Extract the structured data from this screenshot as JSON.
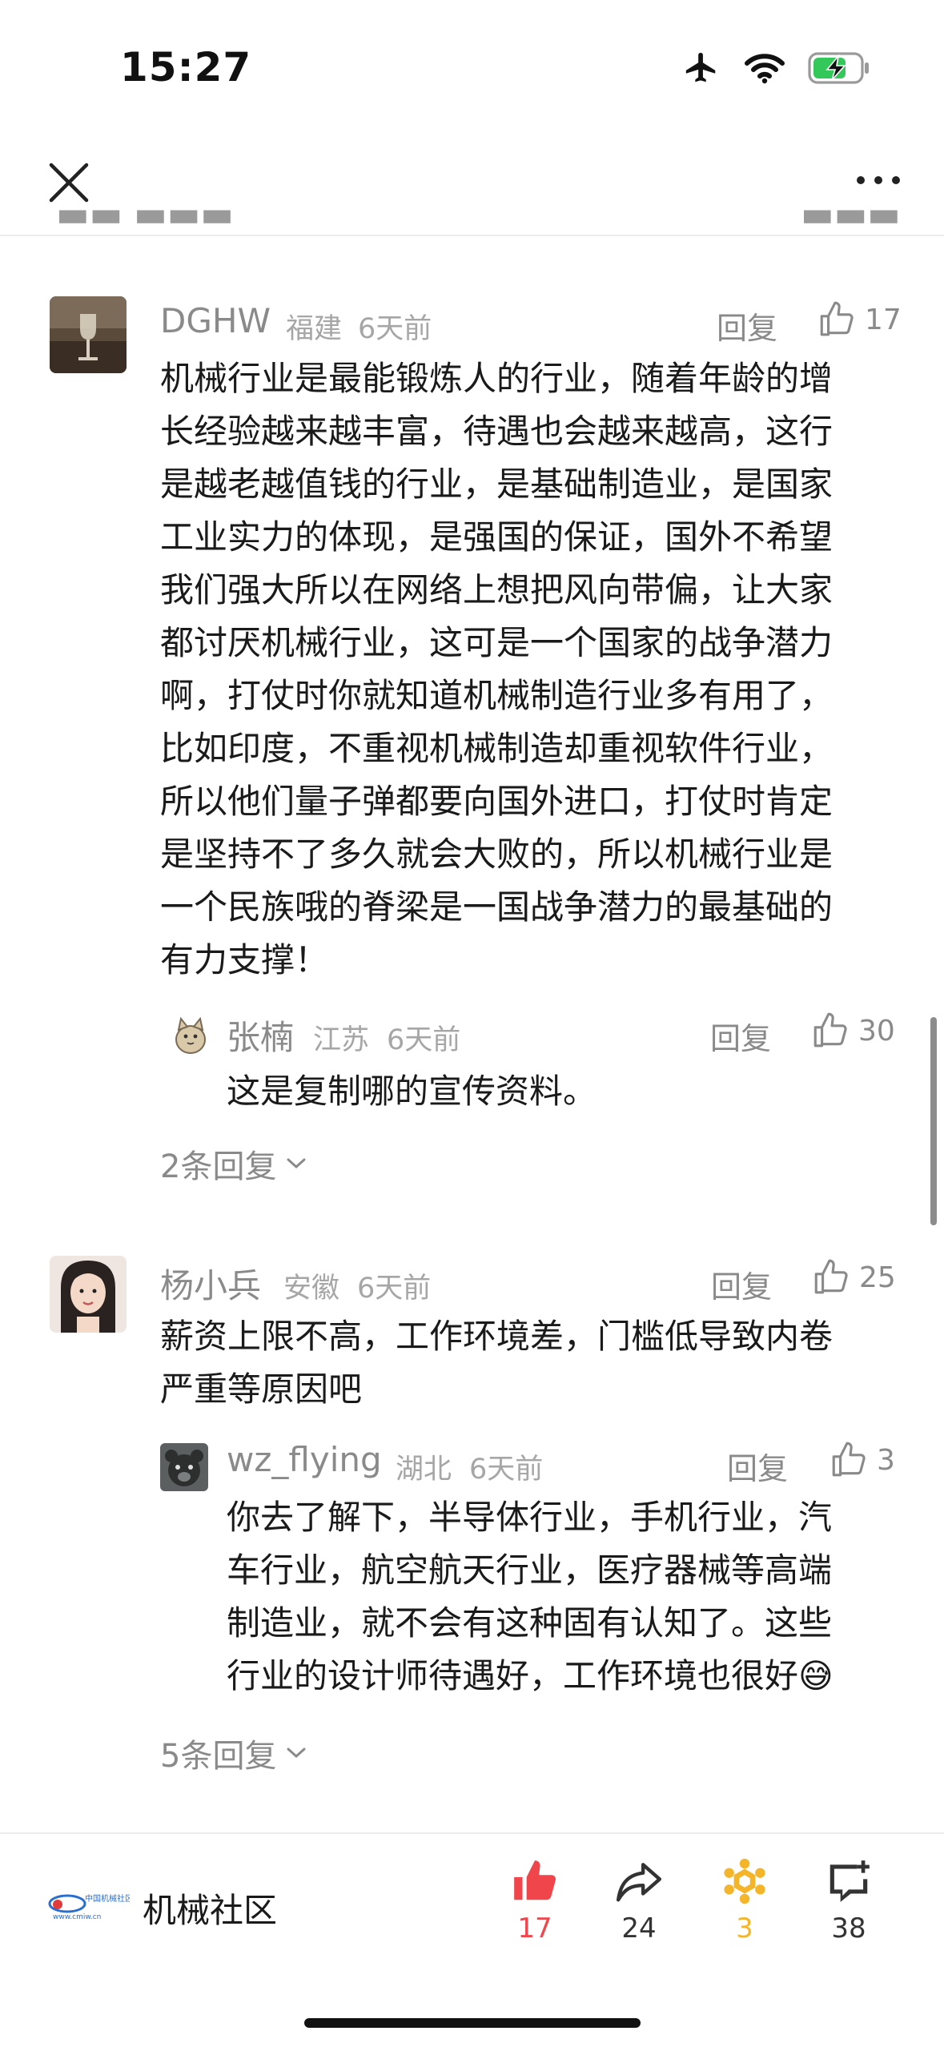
{
  "status_bar": {
    "time": "15:27"
  },
  "comments": [
    {
      "author": "DGHW",
      "location": "福建",
      "time": "6天前",
      "reply_label": "回复",
      "likes": "17",
      "text_lines": [
        "机械行业是最能锻炼人的行业，随着年龄的增",
        "长经验越来越丰富，待遇也会越来越高，这行",
        "是越老越值钱的行业，是基础制造业，是国家",
        "工业实力的体现，是强国的保证，国外不希望",
        "我们强大所以在网络上想把风向带偏，让大家",
        "都讨厌机械行业，这可是一个国家的战争潜力",
        "啊，打仗时你就知道机械制造行业多有用了，",
        "比如印度，不重视机械制造却重视软件行业，",
        "所以他们量子弹都要向国外进口，打仗时肯定",
        "是坚持不了多久就会大败的，所以机械行业是",
        "一个民族哦的脊梁是一国战争潜力的最基础的",
        "有力支撑！"
      ],
      "reply": {
        "author": "张楠",
        "location": "江苏",
        "time": "6天前",
        "reply_label": "回复",
        "likes": "30",
        "text_lines": [
          "这是复制哪的宣传资料。"
        ]
      },
      "more_replies": "2条回复"
    },
    {
      "author": "杨小兵",
      "location": "安徽",
      "time": "6天前",
      "reply_label": "回复",
      "likes": "25",
      "text_lines": [
        "薪资上限不高，工作环境差，门槛低导致内卷",
        "严重等原因吧"
      ],
      "reply": {
        "author": "wz_flying",
        "location": "湖北",
        "time": "6天前",
        "reply_label": "回复",
        "likes": "3",
        "text_lines": [
          "你去了解下，半导体行业，手机行业，汽",
          "车行业，航空航天行业，医疗器械等高端",
          "制造业，就不会有这种固有认知了。这些",
          "行业的设计师待遇好，工作环境也很好"
        ],
        "emoji": "😅"
      },
      "more_replies": "5条回复"
    }
  ],
  "bottom_bar": {
    "brand_name": "机械社区",
    "brand_logo_text": "中国机械社区",
    "brand_logo_url_text": "www.cmiw.cn",
    "like_count": "17",
    "share_count": "24",
    "favorite_count": "3",
    "comment_count": "38",
    "colors": {
      "like": "#f0464b",
      "favorite": "#f5b52a",
      "default": "#333333"
    }
  }
}
